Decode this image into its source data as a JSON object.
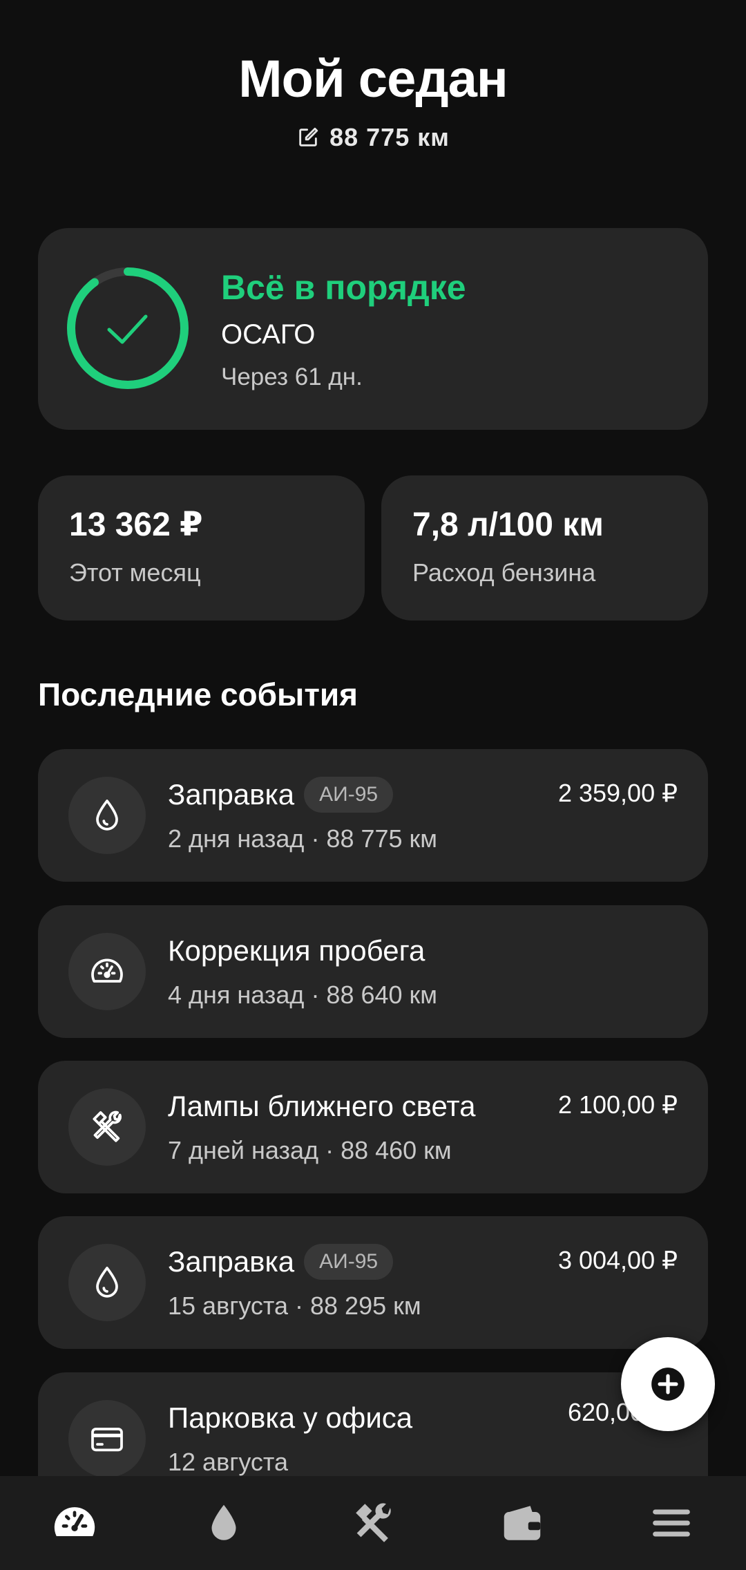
{
  "header": {
    "title": "Мой седан",
    "odometer": "88 775 км"
  },
  "status": {
    "title": "Всё в порядке",
    "item": "ОСАГО",
    "due": "Через 61 дн.",
    "progress": 0.9,
    "accent": "#1fcf7c"
  },
  "stats": {
    "month_value": "13 362 ₽",
    "month_label": "Этот месяц",
    "fuel_value": "7,8 л/100 км",
    "fuel_label": "Расход бензина"
  },
  "events_title": "Последние события",
  "events": [
    {
      "icon": "drop-icon",
      "title": "Заправка",
      "badge": "АИ-95",
      "subtitle": "2 дня назад · 88 775 км",
      "amount": "2 359,00 ₽"
    },
    {
      "icon": "speedometer-icon",
      "title": "Коррекция пробега",
      "badge": "",
      "subtitle": "4 дня назад · 88 640 км",
      "amount": ""
    },
    {
      "icon": "tools-icon",
      "title": "Лампы ближнего света",
      "badge": "",
      "subtitle": "7 дней назад · 88 460 км",
      "amount": "2 100,00 ₽"
    },
    {
      "icon": "drop-icon",
      "title": "Заправка",
      "badge": "АИ-95",
      "subtitle": "15 августа · 88 295 км",
      "amount": "3 004,00 ₽"
    },
    {
      "icon": "card-icon",
      "title": "Парковка у офиса",
      "badge": "",
      "subtitle": "12 августа",
      "amount": "620,00 ₽"
    }
  ],
  "nav": [
    {
      "icon": "speedometer-icon",
      "active": true
    },
    {
      "icon": "drop-icon",
      "active": false
    },
    {
      "icon": "tools-icon",
      "active": false
    },
    {
      "icon": "wallet-icon",
      "active": false
    },
    {
      "icon": "menu-icon",
      "active": false
    }
  ]
}
